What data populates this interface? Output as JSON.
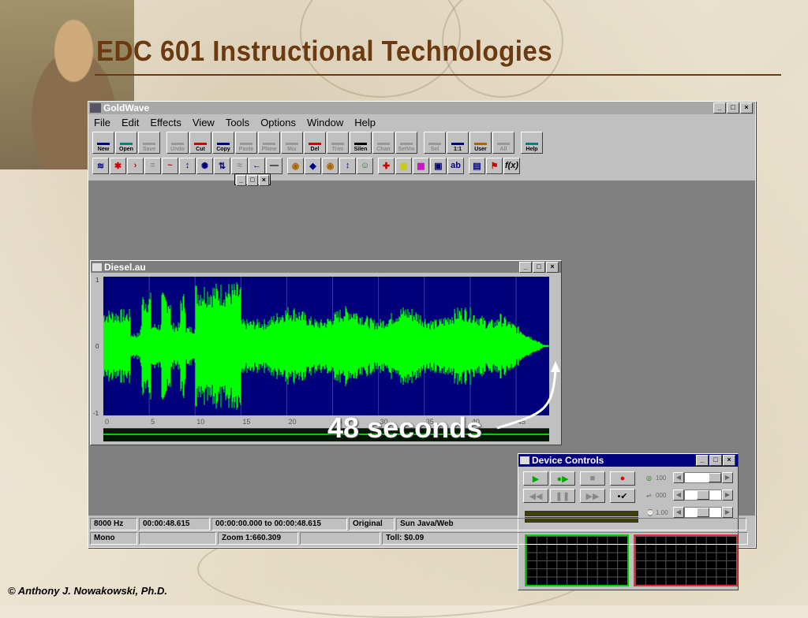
{
  "slide": {
    "title": "EDC 601  Instructional Technologies",
    "copyright": "© Anthony J. Nowakowski, Ph.D.",
    "annotation": "48 seconds"
  },
  "app": {
    "title": "GoldWave",
    "menu": [
      "File",
      "Edit",
      "Effects",
      "View",
      "Tools",
      "Options",
      "Window",
      "Help"
    ],
    "toolbar": [
      [
        "New",
        "Open",
        "Save"
      ],
      [
        "Undo",
        "Cut",
        "Copy",
        "Paste",
        "PNew",
        "Mix",
        "Del",
        "Trim",
        "Silen",
        "Chan",
        "SetVw"
      ],
      [
        "Sel",
        "1:1",
        "User",
        "All"
      ],
      [
        "Help"
      ]
    ],
    "disabled": [
      "Save",
      "Undo",
      "Paste",
      "PNew",
      "Mix",
      "Trim",
      "Chan",
      "SetVw",
      "Sel",
      "All"
    ]
  },
  "document": {
    "title": "Diesel.au",
    "y_labels": [
      "1",
      "0",
      "-1"
    ],
    "time_ticks": [
      "0",
      "5",
      "10",
      "15",
      "20",
      "25",
      "30",
      "35",
      "40",
      "45"
    ]
  },
  "device_controls": {
    "title": "Device Controls",
    "slider_values": [
      "100",
      "000",
      "1.00"
    ]
  },
  "status": {
    "row1": [
      "8000 Hz",
      "00:00:48.615",
      "00:00:00.000 to 00:00:48.615",
      "Original",
      "Sun Java/Web"
    ],
    "row2": [
      "Mono",
      "",
      "Zoom 1:660.309",
      "",
      "Toll: $0.09"
    ]
  },
  "colors": {
    "title_brown": "#6b3a10",
    "wave_green": "#00ff00",
    "wave_bg": "#00007a",
    "active_titlebar": "#000080"
  }
}
